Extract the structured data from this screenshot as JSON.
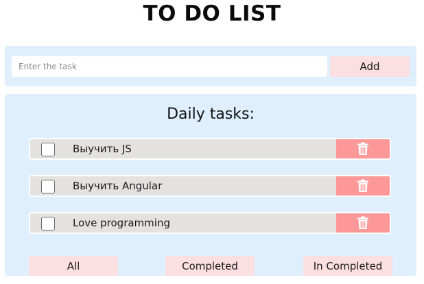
{
  "header": {
    "title": "TO DO LIST"
  },
  "add_form": {
    "input_placeholder": "Enter the task",
    "input_value": "",
    "add_label": "Add"
  },
  "tasks": {
    "heading": "Daily tasks:",
    "items": [
      {
        "label": "Выучить JS",
        "checked": false
      },
      {
        "label": "Выучить Angular",
        "checked": false
      },
      {
        "label": "Love programming",
        "checked": false
      }
    ]
  },
  "filters": {
    "all_label": "All",
    "completed_label": "Completed",
    "incompleted_label": "In Completed"
  },
  "colors": {
    "panel_bg": "#dfeffd",
    "task_bg": "#e4e1e1",
    "delete_bg": "#fc9898",
    "button_bg": "#fcdfe0"
  },
  "icons": {
    "delete": "trash-icon"
  }
}
